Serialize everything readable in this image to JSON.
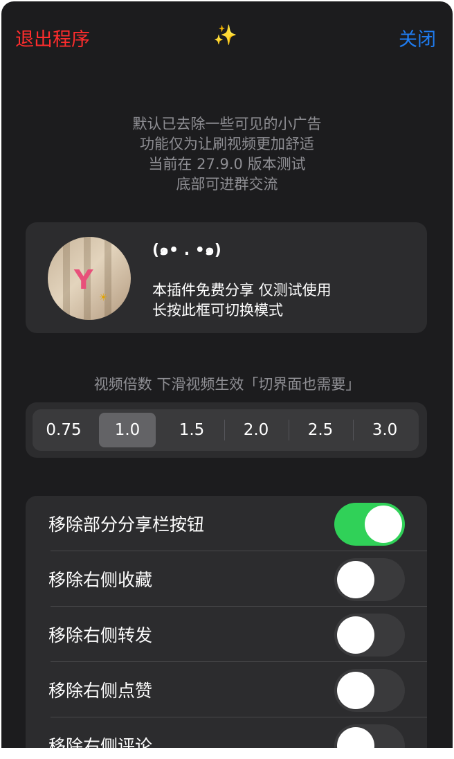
{
  "header": {
    "exit_label": "退出程序",
    "sparkle_icon": "sparkles-icon",
    "close_label": "关闭"
  },
  "notes": [
    "默认已去除一些可见的小广告",
    "功能仅为让刷视频更加舒适",
    "当前在 27.9.0 版本测试",
    "底部可进群交流"
  ],
  "profile": {
    "title": "(๑• . •๑)",
    "line1": "本插件免费分享 仅测试使用",
    "line2": "长按此框可切换模式",
    "avatar_letter": "Y"
  },
  "speed": {
    "caption": "视频倍数 下滑视频生效「切界面也需要」",
    "options": [
      "0.75",
      "1.0",
      "1.5",
      "2.0",
      "2.5",
      "3.0"
    ],
    "selected": "1.0"
  },
  "settings": [
    {
      "label": "移除部分分享栏按钮",
      "on": true
    },
    {
      "label": "移除右侧收藏",
      "on": false
    },
    {
      "label": "移除右侧转发",
      "on": false
    },
    {
      "label": "移除右侧点赞",
      "on": false
    },
    {
      "label": "移除右侧评论",
      "on": false
    }
  ],
  "colors": {
    "sheet_bg": "#1c1c1e",
    "card_bg": "#2c2c2e",
    "exit": "#ff2d2d",
    "close": "#1f7cf0",
    "toggle_on": "#30d158",
    "muted_text": "#8e8e93"
  }
}
